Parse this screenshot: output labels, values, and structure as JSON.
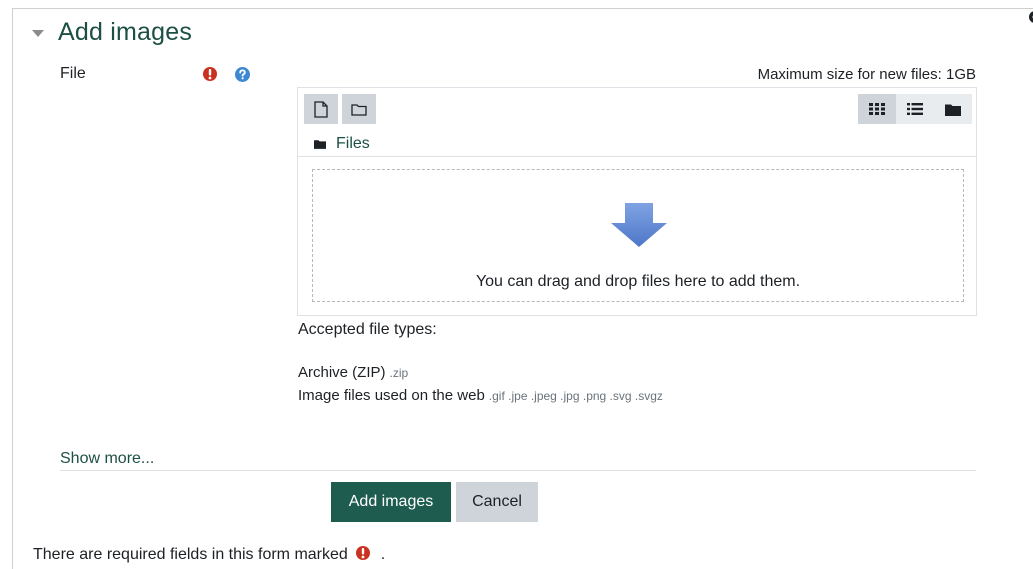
{
  "section": {
    "title": "Add images"
  },
  "field": {
    "label": "File",
    "max_size": "Maximum size for new files: 1GB"
  },
  "filepicker": {
    "path_label": "Files",
    "drop_text": "You can drag and drop files here to add them."
  },
  "accepted": {
    "title": "Accepted file types:",
    "types": [
      {
        "name": "Archive (ZIP)",
        "ext": ".zip"
      },
      {
        "name": "Image files used on the web",
        "ext": ".gif .jpe .jpeg .jpg .png .svg .svgz"
      }
    ]
  },
  "show_more": "Show more...",
  "buttons": {
    "submit": "Add images",
    "cancel": "Cancel"
  },
  "required_note": "There are required fields in this form marked",
  "required_note_suffix": ".",
  "colors": {
    "accent": "#1d5c4f",
    "required": "#ca3120",
    "help": "#3e88d2",
    "arrow": "#5b84d0"
  }
}
